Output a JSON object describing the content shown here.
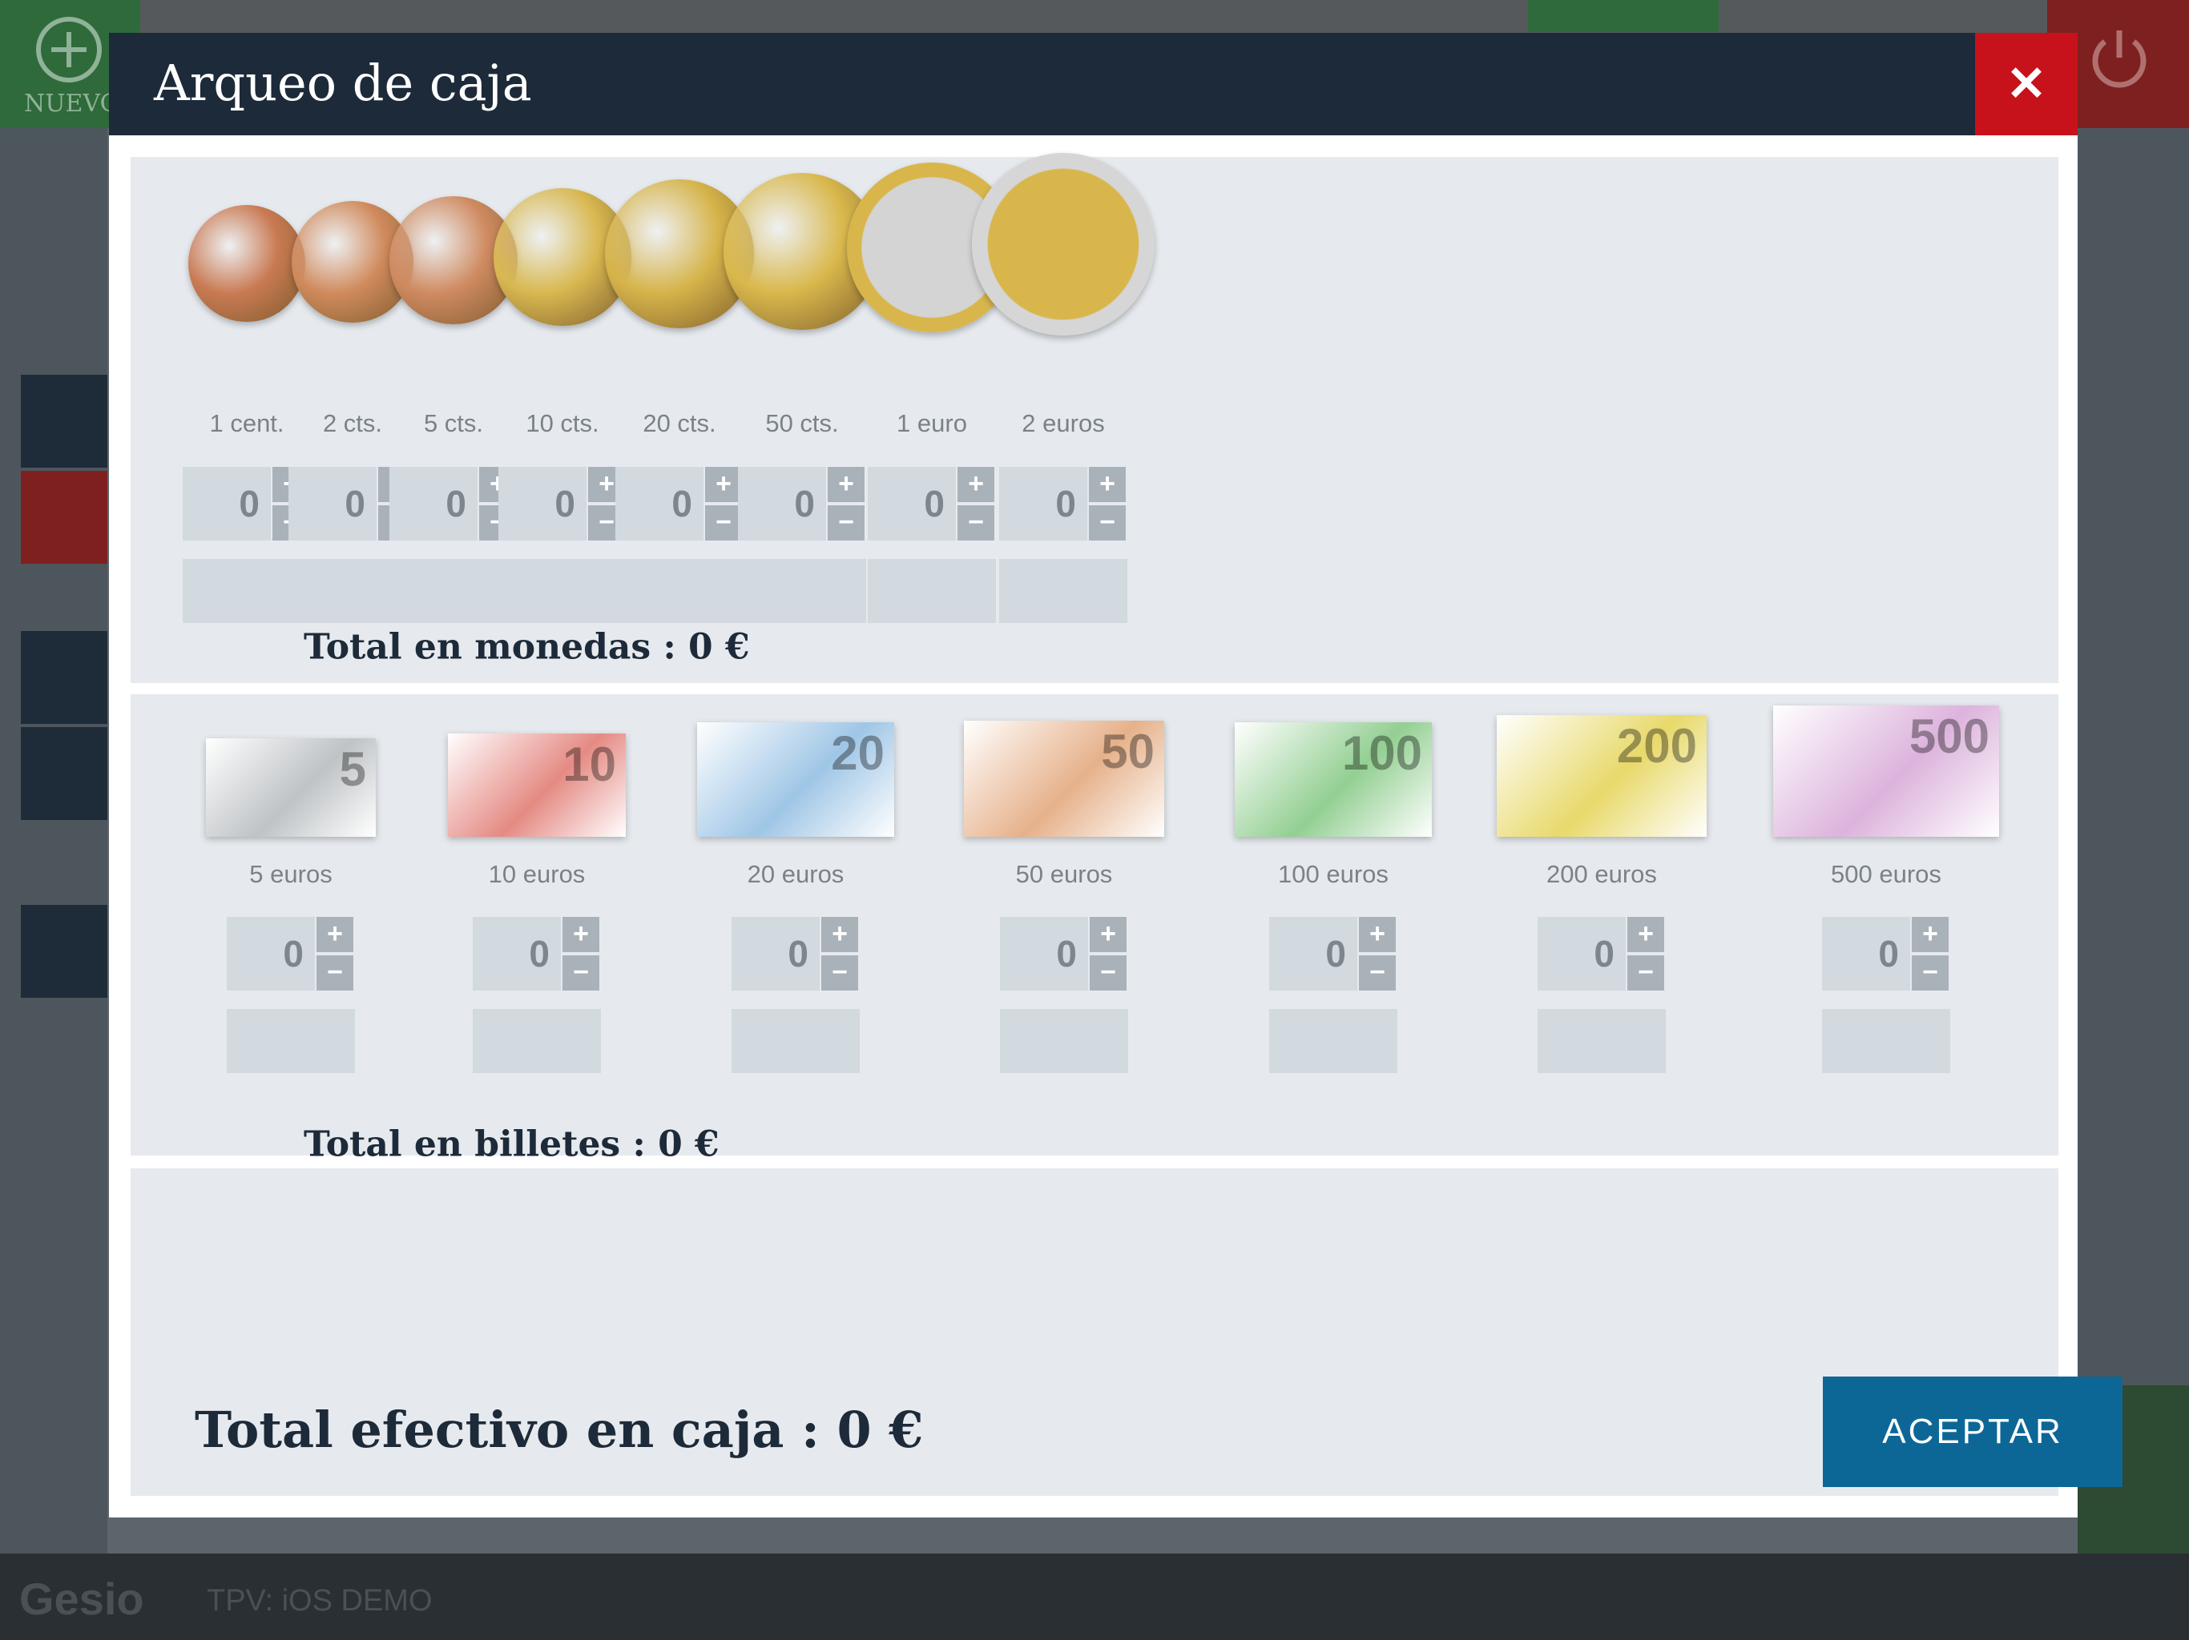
{
  "background": {
    "nuevo_label": "NUEVO",
    "footer_brand": "Gesio",
    "footer_terminal": "TPV: iOS DEMO"
  },
  "modal": {
    "title": "Arqueo de caja",
    "close_icon": "close-icon",
    "coins": [
      {
        "label": "1 cent.",
        "value": "0",
        "color": "#c97a52"
      },
      {
        "label": "2 cts.",
        "value": "0",
        "color": "#d08a5c"
      },
      {
        "label": "5 cts.",
        "value": "0",
        "color": "#cf8a60"
      },
      {
        "label": "10 cts.",
        "value": "0",
        "color": "#d8b850"
      },
      {
        "label": "20 cts.",
        "value": "0",
        "color": "#d6b44a"
      },
      {
        "label": "50 cts.",
        "value": "0",
        "color": "#d9b84c"
      },
      {
        "label": "1 euro",
        "value": "0",
        "color": "#cfcfcf"
      },
      {
        "label": "2 euros",
        "value": "0",
        "color": "#d8b64c"
      }
    ],
    "coins_total": "Total en monedas : 0 €",
    "notes": [
      {
        "label": "5 euros",
        "value": "0",
        "denom": "5",
        "color": "#bfc3c6"
      },
      {
        "label": "10 euros",
        "value": "0",
        "denom": "10",
        "color": "#e58a83"
      },
      {
        "label": "20 euros",
        "value": "0",
        "denom": "20",
        "color": "#9fc6e6"
      },
      {
        "label": "50 euros",
        "value": "0",
        "denom": "50",
        "color": "#e6b18a"
      },
      {
        "label": "100 euros",
        "value": "0",
        "denom": "100",
        "color": "#93cf92"
      },
      {
        "label": "200 euros",
        "value": "0",
        "denom": "200",
        "color": "#e8d96a"
      },
      {
        "label": "500 euros",
        "value": "0",
        "denom": "500",
        "color": "#dcb3dc"
      }
    ],
    "notes_total": "Total en billetes : 0 €",
    "grand_total": "Total efectivo en caja : 0 €",
    "accept_label": "ACEPTAR",
    "plus": "+",
    "minus": "−"
  }
}
